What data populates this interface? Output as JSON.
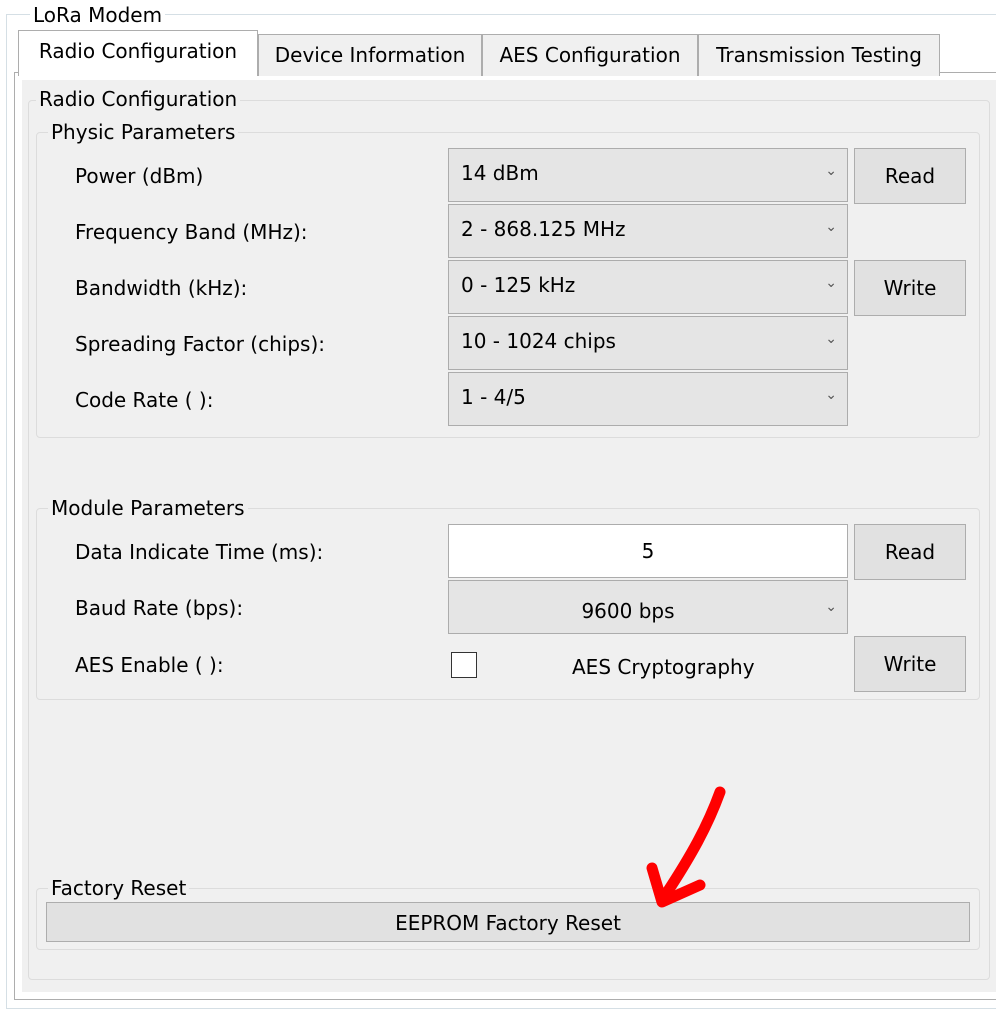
{
  "window": {
    "title": "LoRa Modem"
  },
  "tabs": [
    {
      "label": "Radio Configuration",
      "active": true
    },
    {
      "label": "Device Information",
      "active": false
    },
    {
      "label": "AES Configuration",
      "active": false
    },
    {
      "label": "Transmission Testing",
      "active": false
    }
  ],
  "radio_config": {
    "title": "Radio Configuration",
    "physic": {
      "title": "Physic Parameters",
      "fields": [
        {
          "label": "Power (dBm)",
          "value": "14 dBm"
        },
        {
          "label": "Frequency Band (MHz):",
          "value": "2 - 868.125 MHz"
        },
        {
          "label": "Bandwidth (kHz):",
          "value": "0 - 125 kHz"
        },
        {
          "label": "Spreading Factor (chips):",
          "value": "10 - 1024 chips"
        },
        {
          "label": "Code Rate ( ):",
          "value": "1 - 4/5"
        }
      ],
      "read_button": "Read",
      "write_button": "Write"
    },
    "module": {
      "title": "Module Parameters",
      "data_indicate_label": "Data Indicate Time (ms):",
      "data_indicate_value": "5",
      "baud_label": "Baud Rate (bps):",
      "baud_value": "9600 bps",
      "aes_label": "AES Enable ( ):",
      "aes_checkbox_label": "AES Cryptography",
      "aes_checked": false,
      "read_button": "Read",
      "write_button": "Write"
    },
    "factory": {
      "title": "Factory Reset",
      "button": "EEPROM Factory Reset"
    }
  },
  "annotation": {
    "color": "#ff0000"
  },
  "icons": {
    "dropdown": "chevron-down-icon",
    "annotation": "red-arrow-icon"
  }
}
